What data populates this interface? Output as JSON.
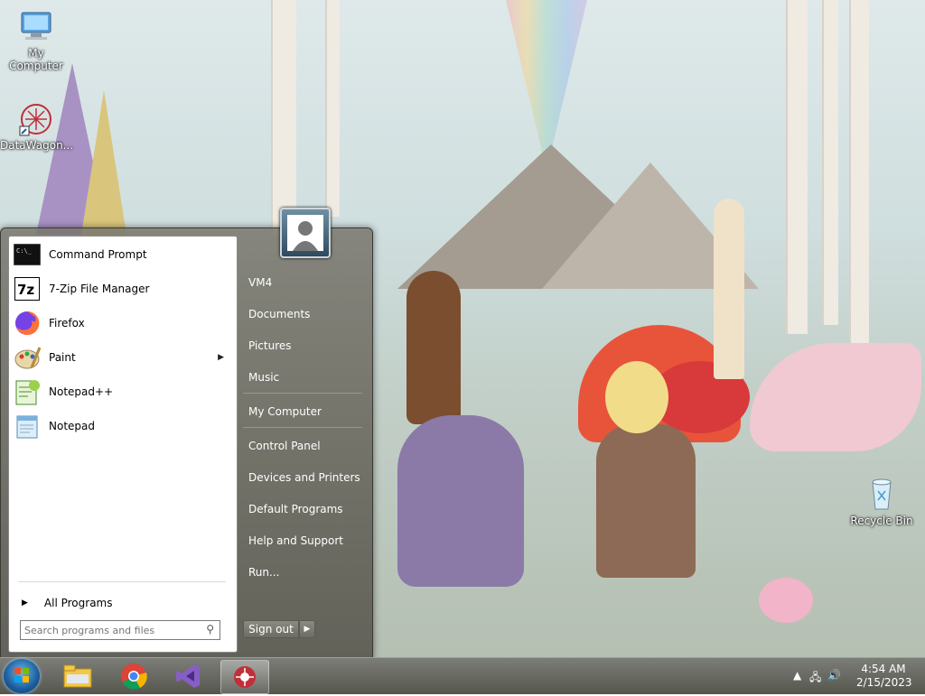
{
  "desktop": {
    "icons": [
      {
        "label": "My Computer",
        "icon": "computer-icon"
      },
      {
        "label": "DataWagon...",
        "icon": "shortcut-icon"
      },
      {
        "label": "Recycle Bin",
        "icon": "recycle-bin-icon"
      }
    ]
  },
  "start_menu": {
    "programs": [
      {
        "label": "Command Prompt",
        "icon": "command-prompt-icon",
        "has_submenu": false
      },
      {
        "label": "7-Zip File Manager",
        "icon": "7zip-icon",
        "has_submenu": false
      },
      {
        "label": "Firefox",
        "icon": "firefox-icon",
        "has_submenu": false
      },
      {
        "label": "Paint",
        "icon": "paint-icon",
        "has_submenu": true
      },
      {
        "label": "Notepad++",
        "icon": "notepadpp-icon",
        "has_submenu": false
      },
      {
        "label": "Notepad",
        "icon": "notepad-icon",
        "has_submenu": false
      }
    ],
    "all_programs": "All Programs",
    "search_placeholder": "Search programs and files",
    "right_items": [
      "VM4",
      "Documents",
      "Pictures",
      "Music",
      "My Computer",
      "Control Panel",
      "Devices and Printers",
      "Default Programs",
      "Help and Support",
      "Run..."
    ],
    "sign_out": "Sign out"
  },
  "taskbar": {
    "pinned": [
      "file-explorer-icon",
      "chrome-icon",
      "visual-studio-icon",
      "app-icon"
    ],
    "time": "4:54 AM",
    "date": "2/15/2023"
  },
  "colors": {
    "start_orb": "#1a5d9e",
    "taskbar": "#6a6c65"
  }
}
